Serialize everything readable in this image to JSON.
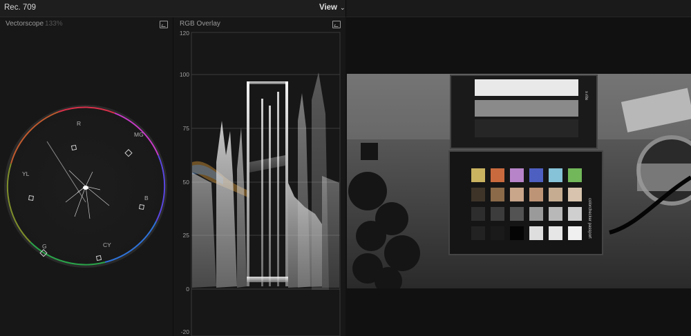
{
  "header": {
    "title": "Rec. 709",
    "view_label": "View"
  },
  "vectorscope": {
    "title": "Vectorscope",
    "zoom": "133%",
    "targets": {
      "r": "R",
      "mg": "MG",
      "b": "B",
      "cy": "CY",
      "g": "G",
      "yl": "YL"
    }
  },
  "rgb_overlay": {
    "title": "RGB Overlay",
    "ticks": [
      "120",
      "100",
      "75",
      "50",
      "25",
      "0",
      "-20"
    ]
  },
  "colors": {
    "background": "#111111",
    "panel": "#171717",
    "graticule": "#3a3a3a",
    "trace": "#ffffff",
    "vectorscope_ring": [
      "#ff2a2a",
      "#ff2ad4",
      "#6a3cff",
      "#2f6bff",
      "#19b5a5",
      "#1fa336",
      "#c7a52a"
    ]
  },
  "viewer": {
    "checker_brand": "x·rite",
    "checker_name": "colorchecker passport"
  }
}
